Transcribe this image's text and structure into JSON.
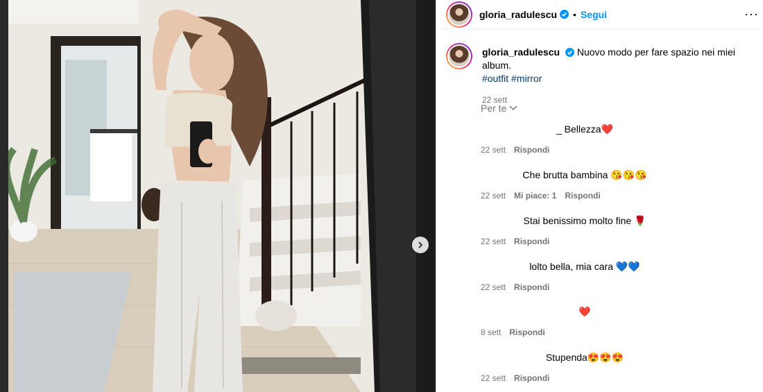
{
  "post": {
    "username": "gloria_radulescu",
    "follow_label": "Segui",
    "more_label": "···",
    "caption": "Nuovo modo per fare spazio nei miei album.",
    "tags": [
      "#outfit",
      "#mirror"
    ],
    "date": "22 sett"
  },
  "sort_label": "Per te",
  "comments": [
    {
      "text": "_ Bellezza❤️",
      "date": "22 sett",
      "likes": "",
      "reply": "Rispondi"
    },
    {
      "text": "Che brutta bambina 😘😘😘",
      "date": "22 sett",
      "likes": "Mi piace: 1",
      "reply": "Rispondi"
    },
    {
      "text": "Stai benissimo molto fine 🌹",
      "date": "22 sett",
      "likes": "",
      "reply": "Rispondi"
    },
    {
      "text": "lolto bella, mia cara 💙💙",
      "date": "22 sett",
      "likes": "",
      "reply": "Rispondi"
    },
    {
      "text": "❤️",
      "date": "8 sett",
      "likes": "",
      "reply": "Rispondi"
    },
    {
      "text": "Stupenda😍😍😍",
      "date": "22 sett",
      "likes": "",
      "reply": "Rispondi"
    }
  ],
  "colors": {
    "accent": "#0095f6",
    "verified": "#0095f6",
    "tag": "#00376b",
    "meta": "#737373"
  }
}
